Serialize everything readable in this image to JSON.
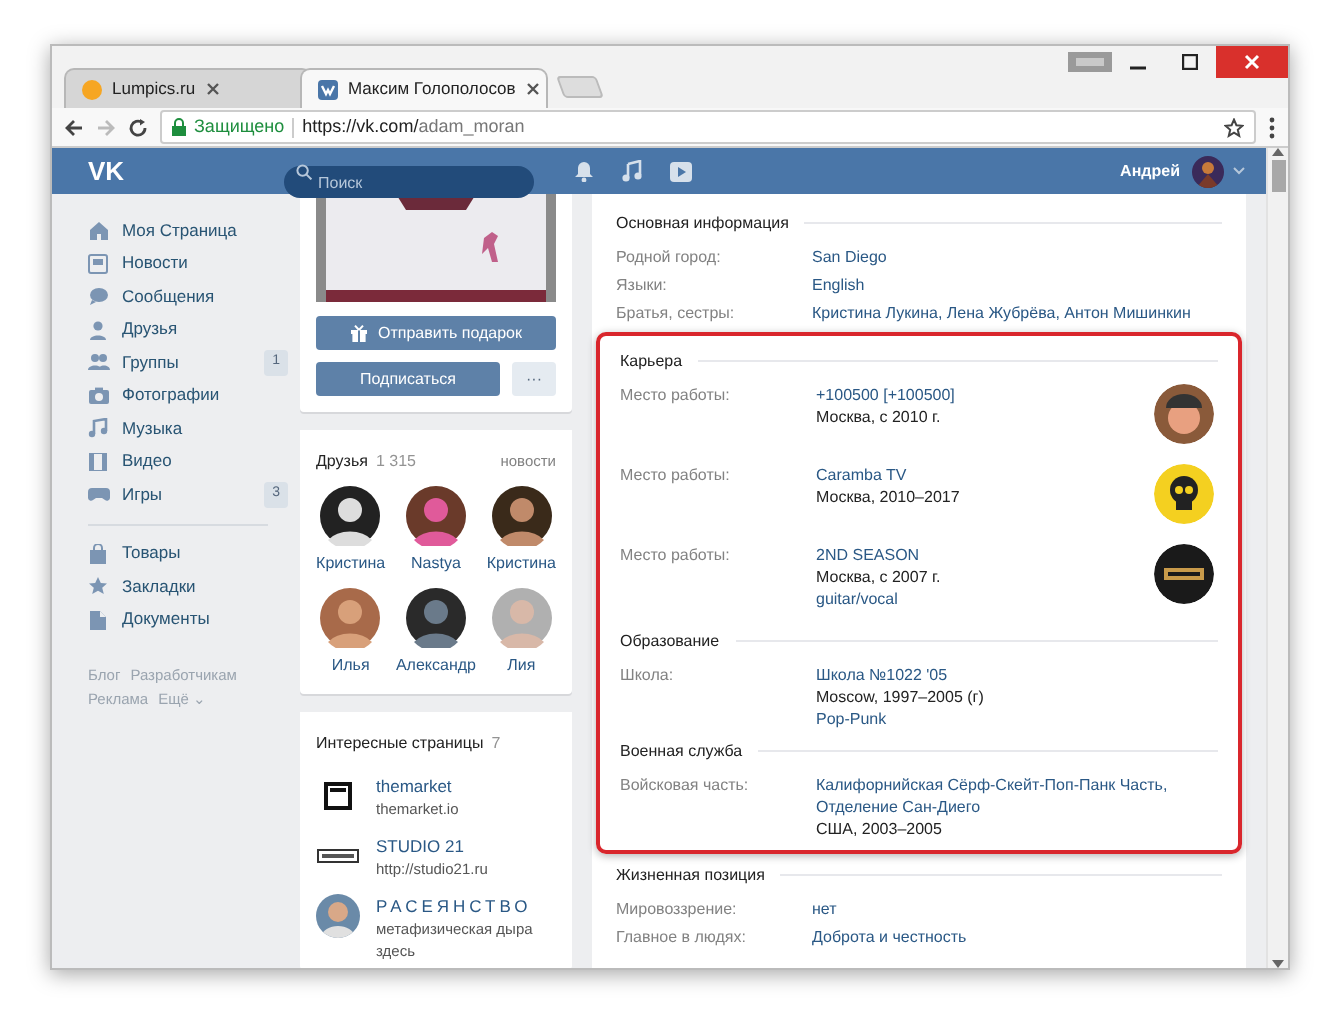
{
  "browser": {
    "tabs": [
      {
        "title": "Lumpics.ru",
        "selected": false
      },
      {
        "title": "Максим Голополосов",
        "selected": true
      }
    ],
    "address": {
      "secure_label": "Защищено",
      "url_host": "https://vk.com/",
      "url_path": "adam_moran"
    }
  },
  "header": {
    "logo": "VK",
    "search_placeholder": "Поиск",
    "user_name": "Андрей"
  },
  "sidebar": {
    "groups": [
      [
        {
          "label": "Моя Страница"
        },
        {
          "label": "Новости"
        },
        {
          "label": "Сообщения"
        },
        {
          "label": "Друзья"
        },
        {
          "label": "Группы",
          "badge": "1"
        },
        {
          "label": "Фотографии"
        },
        {
          "label": "Музыка"
        },
        {
          "label": "Видео"
        },
        {
          "label": "Игры",
          "badge": "3"
        }
      ],
      [
        {
          "label": "Товары"
        },
        {
          "label": "Закладки"
        },
        {
          "label": "Документы"
        }
      ]
    ],
    "footer_links": [
      [
        "Блог",
        "Разработчикам"
      ],
      [
        "Реклама",
        "Ещё ⌄"
      ]
    ]
  },
  "profile": {
    "gift_button": "Отправить подарок",
    "subscribe_button": "Подписаться",
    "more_button": "···"
  },
  "friends": {
    "title": "Друзья",
    "count": "1 315",
    "link": "новости",
    "people": [
      {
        "name": "Кристина"
      },
      {
        "name": "Nastya"
      },
      {
        "name": "Кристина"
      },
      {
        "name": "Илья"
      },
      {
        "name": "Александр"
      },
      {
        "name": "Лия"
      }
    ]
  },
  "pages": {
    "title": "Интересные страницы",
    "count": "7",
    "items": [
      {
        "name": "themarket",
        "subtitle": "themarket.io",
        "letter_spaced": false
      },
      {
        "name": "STUDIO 21",
        "subtitle": "http://studio21.ru",
        "letter_spaced": false
      },
      {
        "name": "РАСЕЯНСТВО",
        "subtitle": "метафизическая дыра здесь",
        "letter_spaced": true
      }
    ]
  },
  "info_blocks": [
    {
      "highlighted": false,
      "sections": [
        {
          "title": "Основная информация",
          "rows": [
            {
              "label": "Родной город:",
              "lines": [
                {
                  "kind": "link",
                  "text": "San Diego"
                }
              ]
            },
            {
              "label": "Языки:",
              "lines": [
                {
                  "kind": "link",
                  "text": "English"
                }
              ]
            },
            {
              "label": "Братья, сестры:",
              "lines": [
                {
                  "kind": "link",
                  "text": "Кристина Лукина, Лена Жубрёва, Антон Мишинкин"
                }
              ]
            }
          ]
        }
      ]
    },
    {
      "highlighted": true,
      "sections": [
        {
          "title": "Карьера",
          "rows": [
            {
              "label": "Место работы:",
              "logo": true,
              "lines": [
                {
                  "kind": "link",
                  "text": "+100500 [+100500]"
                },
                {
                  "kind": "plain",
                  "text": "Москва, с 2010 г."
                }
              ]
            },
            {
              "label": "Место работы:",
              "logo": true,
              "lines": [
                {
                  "kind": "link",
                  "text": "Caramba TV"
                },
                {
                  "kind": "plain",
                  "text": "Москва, 2010–2017"
                }
              ]
            },
            {
              "label": "Место работы:",
              "logo": true,
              "lines": [
                {
                  "kind": "link",
                  "text": "2ND SEASON"
                },
                {
                  "kind": "plain",
                  "text": "Москва, с 2007 г."
                },
                {
                  "kind": "link",
                  "text": "guitar/vocal"
                }
              ]
            }
          ]
        },
        {
          "title": "Образование",
          "rows": [
            {
              "label": "Школа:",
              "lines": [
                {
                  "kind": "link",
                  "text": "Школа №1022 '05"
                },
                {
                  "kind": "plain",
                  "text": "Moscow, 1997–2005 (г)"
                },
                {
                  "kind": "link",
                  "text": "Pop-Punk"
                }
              ]
            }
          ]
        },
        {
          "title": "Военная служба",
          "rows": [
            {
              "label": "Войсковая часть:",
              "lines": [
                {
                  "kind": "link",
                  "text": "Калифорнийская Сёрф-Скейт-Поп-Панк Часть,"
                },
                {
                  "kind": "link",
                  "text": "Отделение Сан-Диего"
                },
                {
                  "kind": "plain",
                  "text": "США, 2003–2005"
                }
              ]
            }
          ]
        }
      ]
    },
    {
      "highlighted": false,
      "sections": [
        {
          "title": "Жизненная позиция",
          "rows": [
            {
              "label": "Мировоззрение:",
              "lines": [
                {
                  "kind": "link",
                  "text": "нет"
                }
              ]
            },
            {
              "label": "Главное в людях:",
              "lines": [
                {
                  "kind": "link",
                  "text": "Доброта и честность"
                }
              ]
            }
          ]
        }
      ]
    }
  ]
}
